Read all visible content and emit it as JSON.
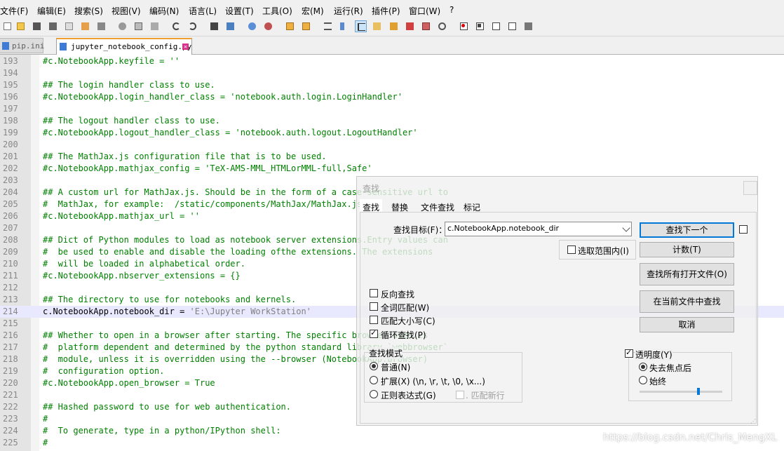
{
  "menu": [
    "文件(F)",
    "编辑(E)",
    "搜索(S)",
    "视图(V)",
    "编码(N)",
    "语言(L)",
    "设置(T)",
    "工具(O)",
    "宏(M)",
    "运行(R)",
    "插件(P)",
    "窗口(W)",
    "?"
  ],
  "toolbar": {
    "icons": [
      "new-file-icon",
      "open-file-icon",
      "save-icon",
      "save-all-icon",
      "close-icon",
      "close-all-icon",
      "print-icon",
      "cut-icon",
      "copy-icon",
      "paste-icon",
      "undo-icon",
      "redo-icon",
      "find-icon",
      "replace-icon",
      "zoom-in-icon",
      "zoom-out-icon",
      "sync-vertical-icon",
      "sync-horizontal-icon",
      "word-wrap-icon",
      "show-all-chars-icon",
      "indent-guide-icon",
      "udl-icon",
      "doc-map-icon",
      "function-list-icon",
      "folder-workspace-icon",
      "monitor-icon",
      "record-macro-icon",
      "stop-record-icon",
      "play-macro-icon",
      "run-macro-multiple-icon",
      "save-macro-icon"
    ],
    "pressed_icon": "indent-guide-icon"
  },
  "tabs": [
    {
      "label": "pip.ini",
      "active": false
    },
    {
      "label": "jupyter_notebook_config.py",
      "active": true
    }
  ],
  "editor": {
    "current_line": "214",
    "lines": [
      {
        "n": "193",
        "code": "#c.NotebookApp.keyfile = ''"
      },
      {
        "n": "194",
        "code": ""
      },
      {
        "n": "195",
        "code": "## The login handler class to use."
      },
      {
        "n": "196",
        "code": "#c.NotebookApp.login_handler_class = 'notebook.auth.login.LoginHandler'"
      },
      {
        "n": "197",
        "code": ""
      },
      {
        "n": "198",
        "code": "## The logout handler class to use."
      },
      {
        "n": "199",
        "code": "#c.NotebookApp.logout_handler_class = 'notebook.auth.logout.LogoutHandler'"
      },
      {
        "n": "200",
        "code": ""
      },
      {
        "n": "201",
        "code": "## The MathJax.js configuration file that is to be used."
      },
      {
        "n": "202",
        "code": "#c.NotebookApp.mathjax_config = 'TeX-AMS-MML_HTMLorMML-full,Safe'"
      },
      {
        "n": "203",
        "code": ""
      },
      {
        "n": "204",
        "code": "## A custom url for MathJax.js. Should be in the form of a case-sensitive url to"
      },
      {
        "n": "205",
        "code": "#  MathJax, for example:  /static/components/MathJax/MathJax.js"
      },
      {
        "n": "206",
        "code": "#c.NotebookApp.mathjax_url = ''"
      },
      {
        "n": "207",
        "code": ""
      },
      {
        "n": "208",
        "code": "## Dict of Python modules to load as notebook server extensions.Entry values can"
      },
      {
        "n": "209",
        "code": "#  be used to enable and disable the loading ofthe extensions. The extensions"
      },
      {
        "n": "210",
        "code": "#  will be loaded in alphabetical order."
      },
      {
        "n": "211",
        "code": "#c.NotebookApp.nbserver_extensions = {}"
      },
      {
        "n": "212",
        "code": ""
      },
      {
        "n": "213",
        "code": "## The directory to use for notebooks and kernels."
      },
      {
        "n": "214",
        "code": "c.NotebookApp.notebook_dir = ",
        "str": "'E:\\Jupyter WorkStation'"
      },
      {
        "n": "215",
        "code": ""
      },
      {
        "n": "216",
        "code": "## Whether to open in a browser after starting. The specific browser used is"
      },
      {
        "n": "217",
        "code": "#  platform dependent and determined by the python standard library `webbrowser`"
      },
      {
        "n": "218",
        "code": "#  module, unless it is overridden using the --browser (NotebookApp.browser)"
      },
      {
        "n": "219",
        "code": "#  configuration option."
      },
      {
        "n": "220",
        "code": "#c.NotebookApp.open_browser = True"
      },
      {
        "n": "221",
        "code": ""
      },
      {
        "n": "222",
        "code": "## Hashed password to use for web authentication."
      },
      {
        "n": "223",
        "code": "#"
      },
      {
        "n": "224",
        "code": "#  To generate, type in a python/IPython shell:"
      },
      {
        "n": "225",
        "code": "#"
      }
    ]
  },
  "find_dialog": {
    "title": "查找",
    "tabs": [
      "查找",
      "替换",
      "文件查找",
      "标记"
    ],
    "active_tab": "查找",
    "find_label": "查找目标(F)：",
    "find_value": "c.NotebookApp.notebook_dir",
    "buttons": {
      "find_next": "查找下一个",
      "count": "计数(T)",
      "find_all_opened": "查找所有打开文件(O)",
      "find_in_current": "在当前文件中查找",
      "cancel": "取消"
    },
    "in_selection": "选取范围内(I)",
    "options": [
      {
        "label": "反向查找",
        "checked": false
      },
      {
        "label": "全词匹配(W)",
        "checked": false
      },
      {
        "label": "匹配大小写(C)",
        "checked": false
      },
      {
        "label": "循环查找(P)",
        "checked": true
      }
    ],
    "search_mode_title": "查找模式",
    "search_modes": [
      {
        "label": "普通(N)",
        "selected": true
      },
      {
        "label": "扩展(X) (\\n, \\r, \\t, \\0, \\x...)",
        "selected": false
      },
      {
        "label": "正则表达式(G)",
        "selected": false
      }
    ],
    "match_newline": ". 匹配新行",
    "transparency_label": "透明度(Y)",
    "transparency_checked": true,
    "transparency_modes": [
      {
        "label": "失去焦点后",
        "selected": true
      },
      {
        "label": "始终",
        "selected": false
      }
    ],
    "transparency_level": 0.72
  },
  "watermark": "https://blog.csdn.net/Chris_MengXL"
}
